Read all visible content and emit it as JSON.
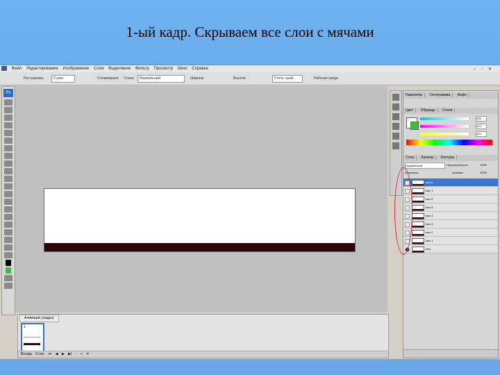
{
  "slide_title": "1-ый кадр. Скрываем все слои с мячами",
  "menubar": {
    "items": [
      "Файл",
      "Редактирование",
      "Изображение",
      "Слои",
      "Выделение",
      "Фильтр",
      "Просмотр",
      "Окно",
      "Справка"
    ]
  },
  "options_bar": {
    "feather_label": "Растушевка:",
    "feather_value": "0 пикс",
    "antialias_label": "Сглаживание",
    "style_label": "Стиль:",
    "style_value": "Нормальный",
    "width_label": "Ширина:",
    "height_label": "Высота:",
    "refine_edge": "Уточн. край...",
    "workspace": "Рабочая среда"
  },
  "animation_panel": {
    "tab_label": "Анимация (кадры)",
    "frame_number": "1",
    "frame_delay": "0 сек.",
    "loop_label": "Всегда"
  },
  "panels": {
    "tabs_top": [
      "Навигатор",
      "Гистограмма",
      "Инфо"
    ],
    "tabs_color": [
      "Цвет",
      "Образцы",
      "Стили"
    ],
    "color_values": [
      "255",
      "204",
      "204"
    ],
    "tabs_layers": [
      "Слои",
      "Каналы",
      "Контуры"
    ],
    "blend_mode": "Нормальный",
    "opacity_label": "Непрозрачность:",
    "opacity_value": "100%",
    "lock_label": "Закрепить:",
    "fill_label": "Заливка:",
    "fill_value": "100%",
    "layers": [
      {
        "name": "мяч 8",
        "visible": false,
        "selected": true
      },
      {
        "name": "мяч 7",
        "visible": false,
        "selected": false
      },
      {
        "name": "мяч 6",
        "visible": false,
        "selected": false
      },
      {
        "name": "мяч 5",
        "visible": false,
        "selected": false
      },
      {
        "name": "мяч 4",
        "visible": false,
        "selected": false
      },
      {
        "name": "мяч 3",
        "visible": false,
        "selected": false
      },
      {
        "name": "мяч 2",
        "visible": false,
        "selected": false
      },
      {
        "name": "мяч 1",
        "visible": false,
        "selected": false
      },
      {
        "name": "Фон",
        "visible": true,
        "selected": false
      }
    ]
  },
  "colors": {
    "highlight": "#d0243c",
    "doc_strip": "#2a0606",
    "layer_selected": "#3a76d0"
  }
}
